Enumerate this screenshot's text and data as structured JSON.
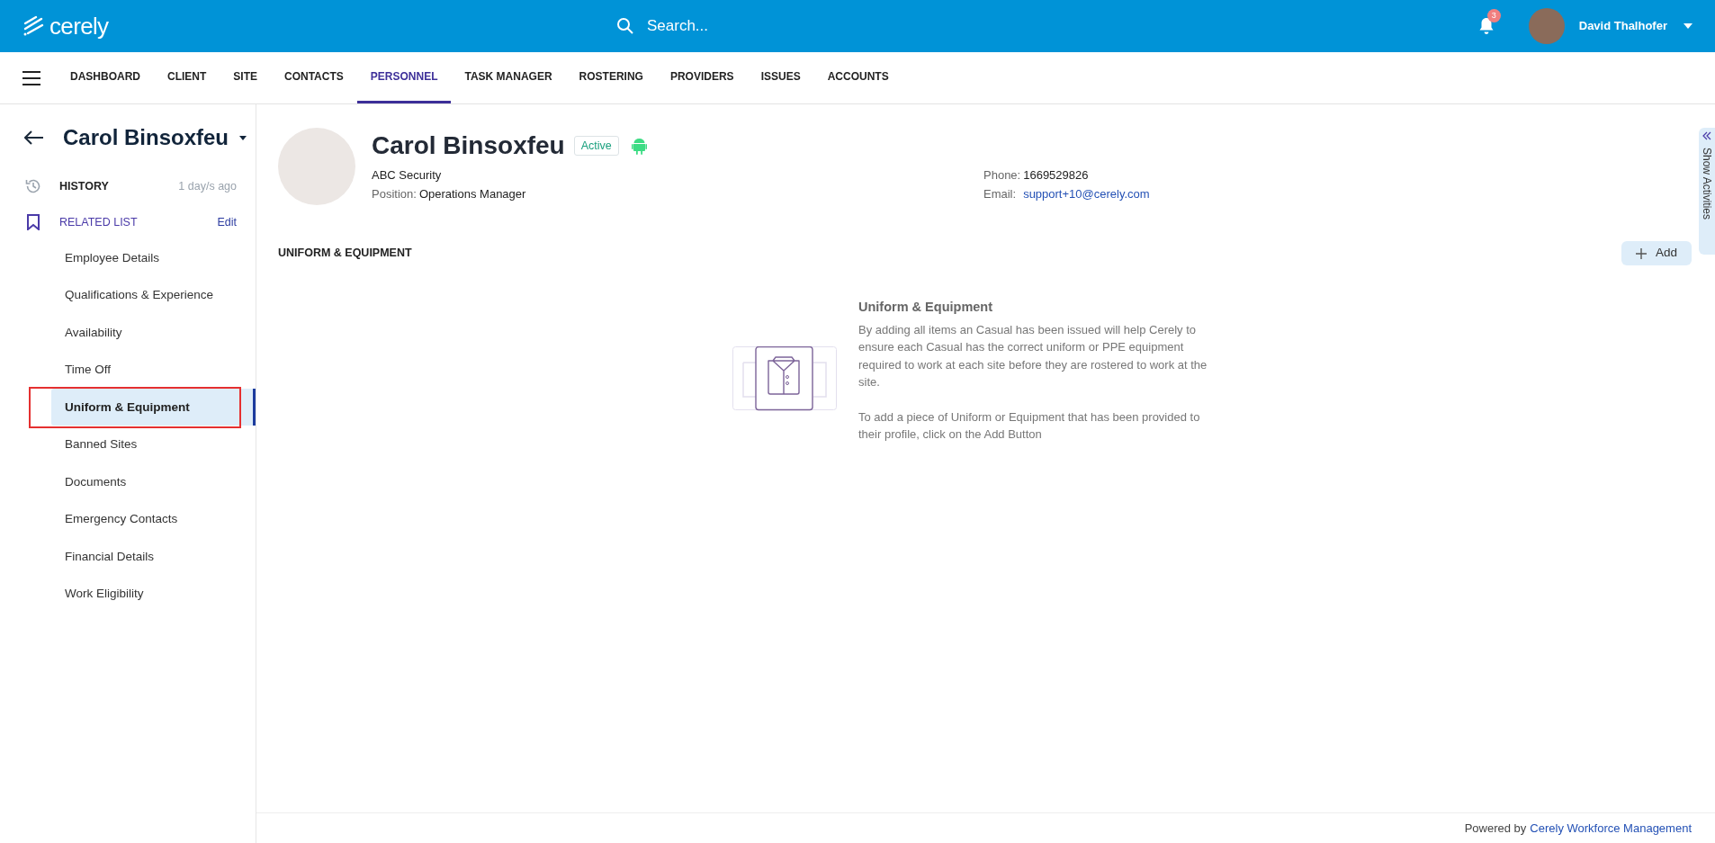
{
  "header": {
    "logo": "cerely",
    "search": {
      "placeholder": "Search..."
    },
    "notifications": "3",
    "user": "David Thalhofer"
  },
  "nav": [
    {
      "label": "DASHBOARD",
      "selected": false
    },
    {
      "label": "CLIENT",
      "selected": false
    },
    {
      "label": "SITE",
      "selected": false
    },
    {
      "label": "CONTACTS",
      "selected": false
    },
    {
      "label": "PERSONNEL",
      "selected": true
    },
    {
      "label": "TASK MANAGER",
      "selected": false
    },
    {
      "label": "ROSTERING",
      "selected": false
    },
    {
      "label": "PROVIDERS",
      "selected": false
    },
    {
      "label": "ISSUES",
      "selected": false
    },
    {
      "label": "ACCOUNTS",
      "selected": false
    }
  ],
  "sidebar": {
    "title": "Carol Binsoxfeu",
    "history": {
      "label": "HISTORY",
      "time": "1 day/s ago"
    },
    "related": {
      "label": "RELATED LIST",
      "action": "Edit"
    },
    "items": [
      {
        "label": "Employee Details",
        "selected": false
      },
      {
        "label": "Qualifications & Experience",
        "selected": false
      },
      {
        "label": "Availability",
        "selected": false
      },
      {
        "label": "Time Off",
        "selected": false
      },
      {
        "label": "Uniform & Equipment",
        "selected": true
      },
      {
        "label": "Banned Sites",
        "selected": false
      },
      {
        "label": "Documents",
        "selected": false
      },
      {
        "label": "Emergency Contacts",
        "selected": false
      },
      {
        "label": "Financial Details",
        "selected": false
      },
      {
        "label": "Work Eligibility",
        "selected": false
      }
    ]
  },
  "profile": {
    "name": "Carol Binsoxfeu",
    "status": "Active",
    "company": "ABC Security",
    "position_label": "Position:",
    "position": "Operations Manager",
    "phone_label": "Phone:",
    "phone": "1669529826",
    "email_label": "Email:",
    "email": "support+10@cerely.com"
  },
  "section": {
    "title": "UNIFORM & EQUIPMENT",
    "add_button": "Add",
    "empty_title": "Uniform & Equipment",
    "empty_text": [
      "By adding all items an Casual has been issued will help Cerely to ensure each Casual has the correct uniform or PPE equipment required to work at each site before they are rostered to work at the site.",
      "To add a piece of Uniform or Equipment that has been provided to their profile, click on the Add Button"
    ]
  },
  "activities_tab": "Show Activities",
  "footer": {
    "text": "Powered by",
    "link": "Cerely Workforce Management"
  }
}
